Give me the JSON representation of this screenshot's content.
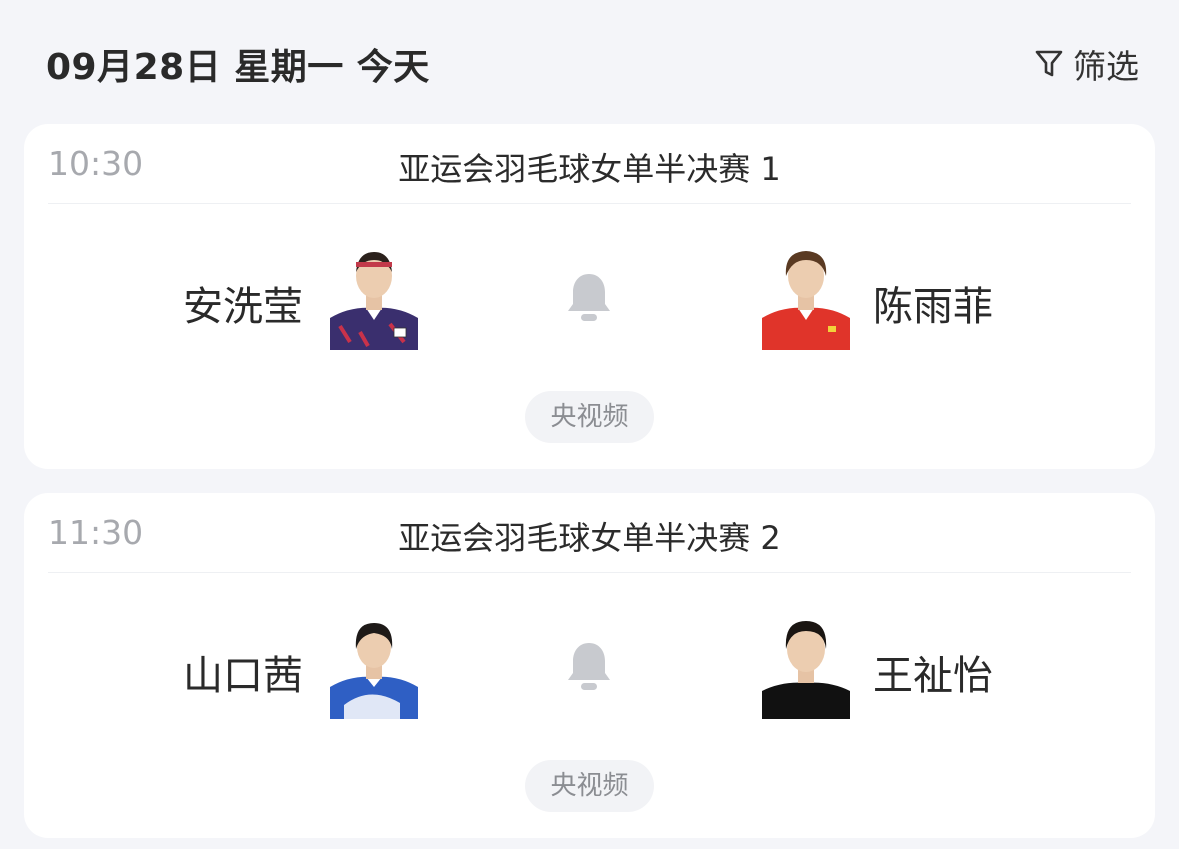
{
  "header": {
    "date_title": "09月28日 星期一 今天",
    "filter_label": "筛选",
    "filter_icon": "filter-icon"
  },
  "colors": {
    "page_background": "#f4f5f9",
    "card_background": "#ffffff",
    "muted_text": "#a7a9ae",
    "bell_icon": "#c8cacf",
    "badge_background": "#f2f3f6",
    "kor_jersey": "#3a2f6e",
    "chn_jersey": "#e0342a",
    "jpn_jersey": "#2f5fc4",
    "black_shirt": "#111111"
  },
  "matches": [
    {
      "time": "10:30",
      "title": "亚运会羽毛球女单半决赛 1",
      "player_left": {
        "name": "安洗莹",
        "avatar": "player-photo-an-se-young"
      },
      "player_right": {
        "name": "陈雨菲",
        "avatar": "player-photo-chen-yufei"
      },
      "reminder_icon": "bell-icon",
      "channel": "央视频"
    },
    {
      "time": "11:30",
      "title": "亚运会羽毛球女单半决赛 2",
      "player_left": {
        "name": "山口茜",
        "avatar": "player-photo-akane-yamaguchi"
      },
      "player_right": {
        "name": "王祉怡",
        "avatar": "player-photo-wang-zhiyi"
      },
      "reminder_icon": "bell-icon",
      "channel": "央视频"
    }
  ]
}
